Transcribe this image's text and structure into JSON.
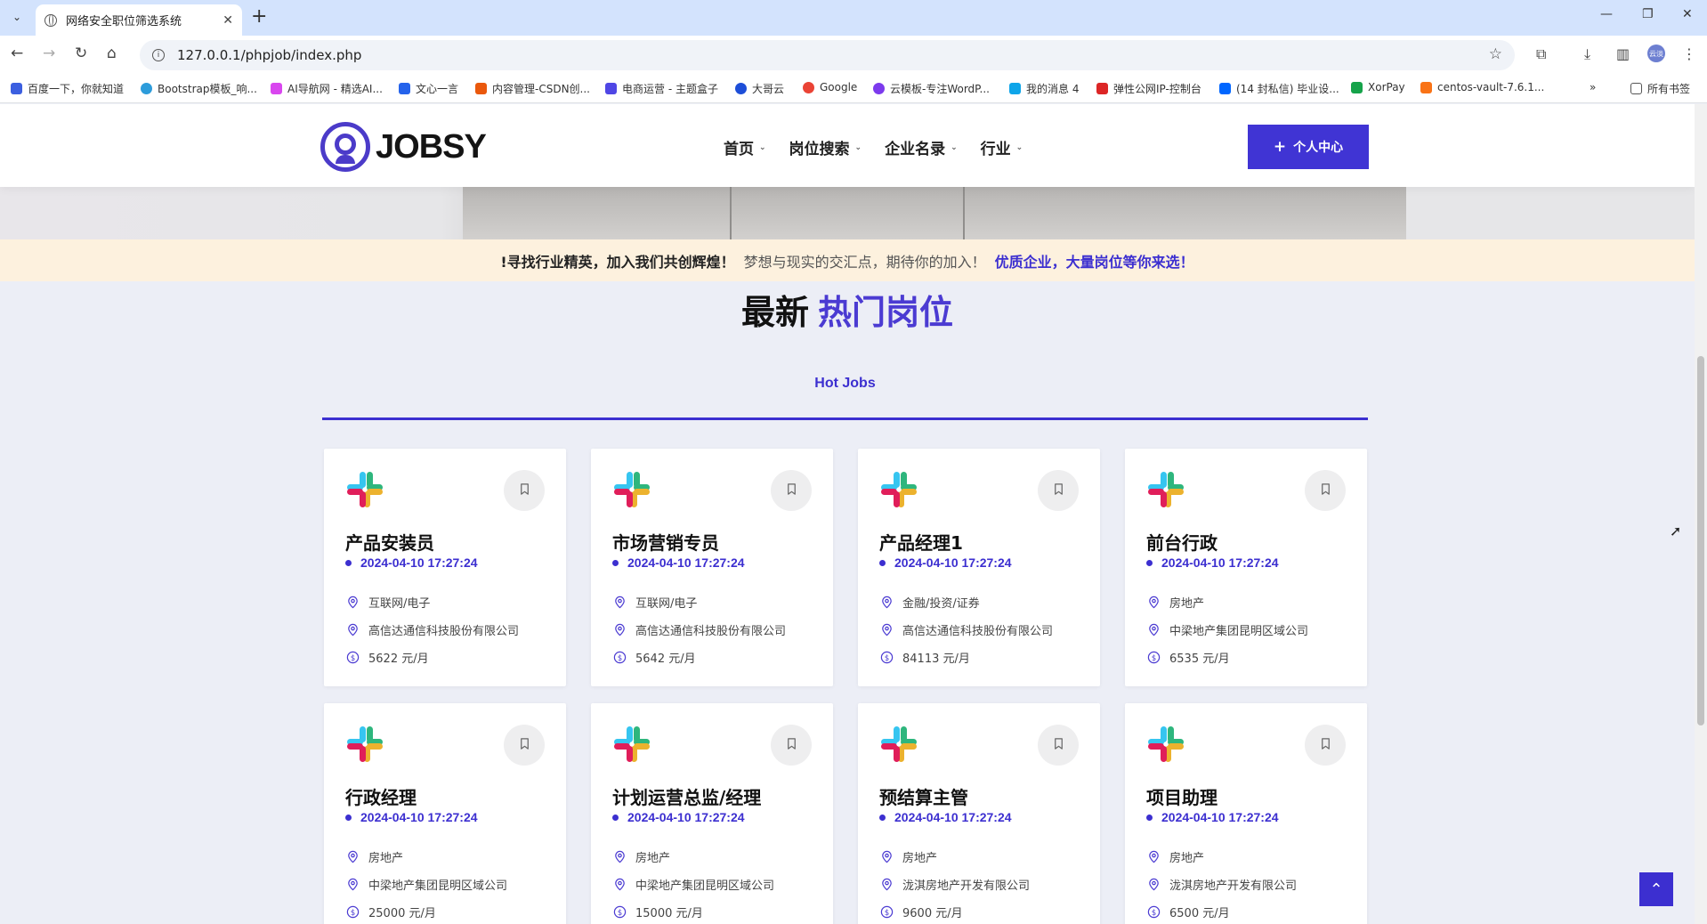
{
  "browser": {
    "tab_title": "网络安全职位筛选系统",
    "url": "127.0.0.1/phpjob/index.php",
    "profile_label": "云淡",
    "bookmarks": [
      {
        "label": "百度一下，你就知道",
        "color": "#3c5fe0"
      },
      {
        "label": "Bootstrap模板_响...",
        "color": "#2d9cdb"
      },
      {
        "label": "AI导航网 - 精选AI...",
        "color": "#d946ef"
      },
      {
        "label": "文心一言",
        "color": "#2563eb"
      },
      {
        "label": "内容管理-CSDN创...",
        "color": "#ea580c"
      },
      {
        "label": "电商运营 - 主题盒子",
        "color": "#4f46e5"
      },
      {
        "label": "大哥云",
        "color": "#1d4ed8"
      },
      {
        "label": "Google",
        "color": "#ea4335"
      },
      {
        "label": "云模板-专注WordP...",
        "color": "#7c3aed"
      },
      {
        "label": "我的消息 4",
        "color": "#0ea5e9"
      },
      {
        "label": "弹性公网IP-控制台",
        "color": "#dc2626"
      },
      {
        "label": "(14 封私信) 毕业设...",
        "color": "#0066ff"
      },
      {
        "label": "XorPay",
        "color": "#16a34a"
      },
      {
        "label": "centos-vault-7.6.1...",
        "color": "#f97316"
      }
    ],
    "all_bookmarks_label": "所有书签"
  },
  "site": {
    "logo_text": "JOBSY",
    "nav": [
      "首页",
      "岗位搜索",
      "企业名录",
      "行业"
    ],
    "cta_label": "个人中心",
    "banner": {
      "part1": "!寻找行业精英，加入我们共创辉煌！",
      "part2": "梦想与现实的交汇点，期待你的加入！",
      "part3": "优质企业，大量岗位等你来选！"
    },
    "section_title_1": "最新",
    "section_title_2": "热门岗位",
    "tab_label": "Hot Jobs"
  },
  "jobs": [
    {
      "title": "产品安装员",
      "date": "2024-04-10 17:27:24",
      "industry": "互联网/电子",
      "company": "高信达通信科技股份有限公司",
      "salary": "5622 元/月"
    },
    {
      "title": "市场营销专员",
      "date": "2024-04-10 17:27:24",
      "industry": "互联网/电子",
      "company": "高信达通信科技股份有限公司",
      "salary": "5642 元/月"
    },
    {
      "title": "产品经理1",
      "date": "2024-04-10 17:27:24",
      "industry": "金融/投资/证券",
      "company": "高信达通信科技股份有限公司",
      "salary": "84113 元/月"
    },
    {
      "title": "前台行政",
      "date": "2024-04-10 17:27:24",
      "industry": "房地产",
      "company": "中梁地产集团昆明区域公司",
      "salary": "6535 元/月"
    },
    {
      "title": "行政经理",
      "date": "2024-04-10 17:27:24",
      "industry": "房地产",
      "company": "中梁地产集团昆明区域公司",
      "salary": "25000 元/月"
    },
    {
      "title": "计划运营总监/经理",
      "date": "2024-04-10 17:27:24",
      "industry": "房地产",
      "company": "中梁地产集团昆明区域公司",
      "salary": "15000 元/月"
    },
    {
      "title": "预结算主管",
      "date": "2024-04-10 17:27:24",
      "industry": "房地产",
      "company": "泷淇房地产开发有限公司",
      "salary": "9600 元/月"
    },
    {
      "title": "项目助理",
      "date": "2024-04-10 17:27:24",
      "industry": "房地产",
      "company": "泷淇房地产开发有限公司",
      "salary": "6500 元/月"
    }
  ],
  "colors": {
    "accent": "#3c2fd0",
    "banner_bg": "#fdf1de"
  }
}
